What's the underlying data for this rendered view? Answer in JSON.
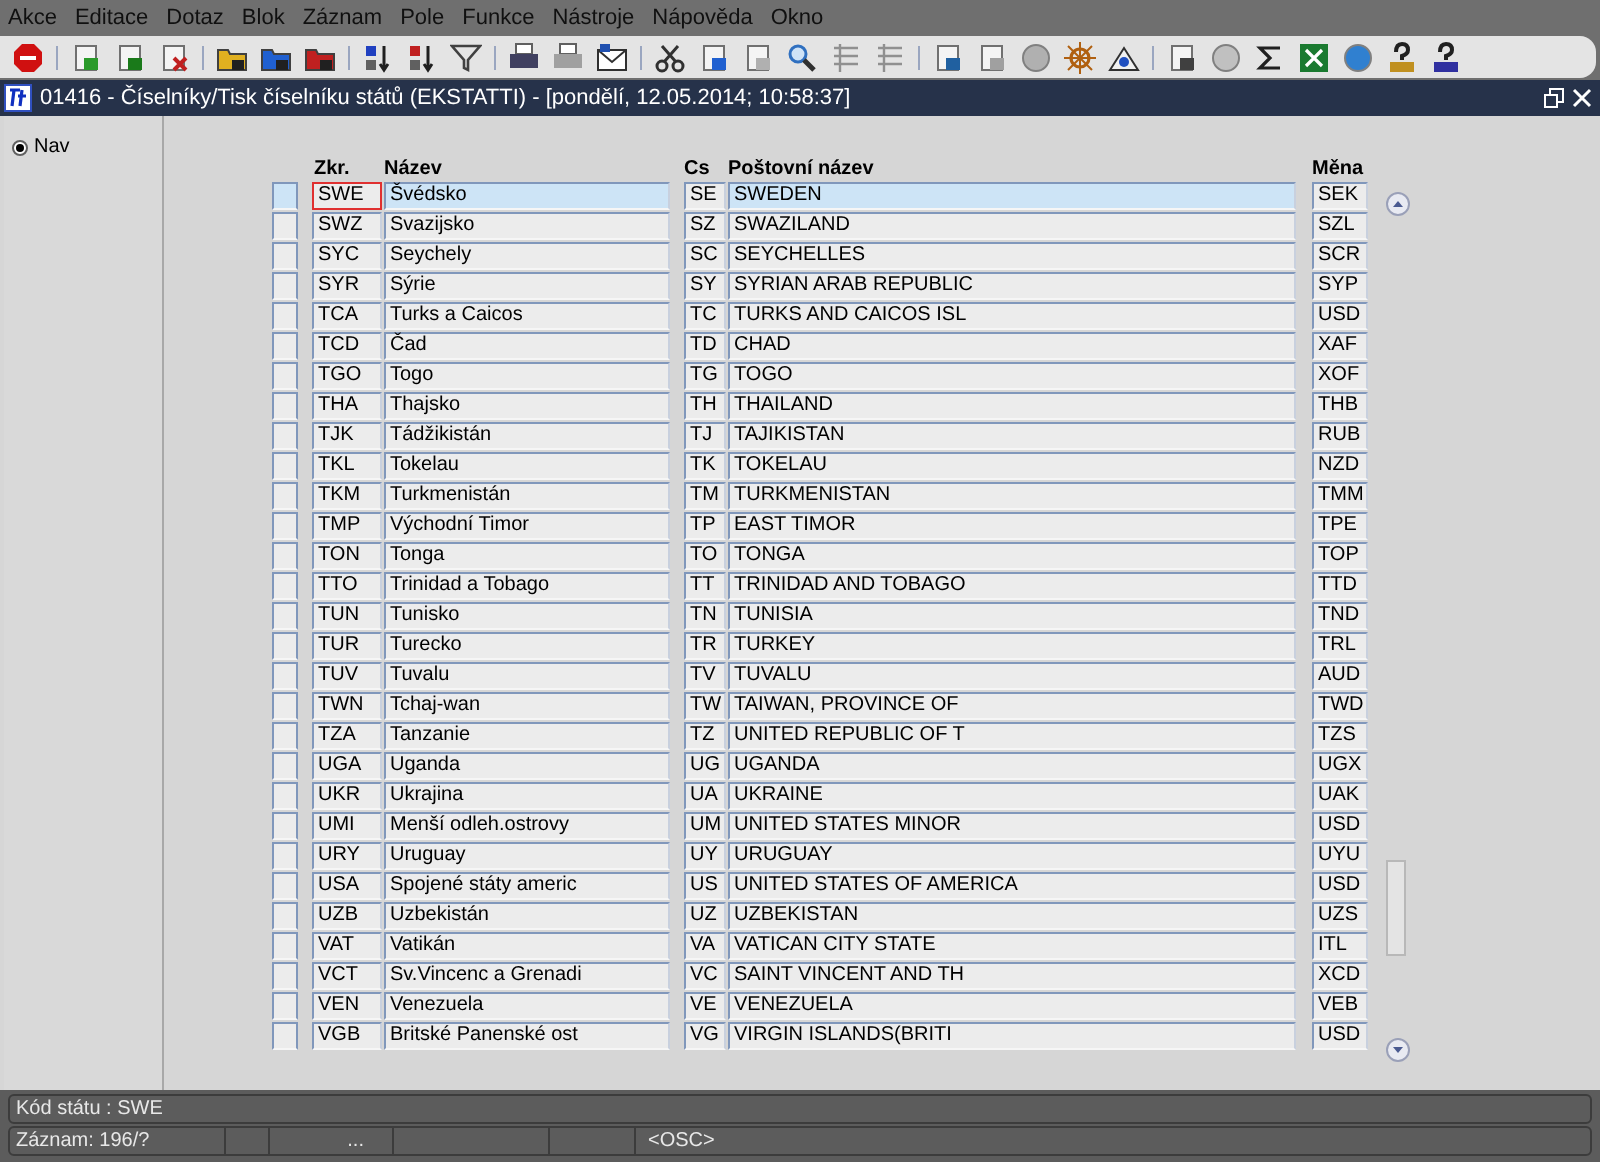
{
  "menu": [
    "Akce",
    "Editace",
    "Dotaz",
    "Blok",
    "Záznam",
    "Pole",
    "Funkce",
    "Nástroje",
    "Nápověda",
    "Okno"
  ],
  "window": {
    "title": "01416 - Číselníky/Tisk číselníku států (EKSTATTI) - [pondělí, 12.05.2014; 10:58:37]"
  },
  "nav": {
    "label": "Nav",
    "checked": true
  },
  "table": {
    "columns": {
      "zkr": "Zkr.",
      "nazev": "Název",
      "cs": "Cs",
      "postovni": "Poštovní název",
      "mena": "Měna"
    },
    "rows": [
      {
        "selected": true,
        "zkr": "SWE",
        "nazev": "Švédsko",
        "cs": "SE",
        "postovni": "SWEDEN",
        "mena": "SEK"
      },
      {
        "selected": false,
        "zkr": "SWZ",
        "nazev": "Svazijsko",
        "cs": "SZ",
        "postovni": "SWAZILAND",
        "mena": "SZL"
      },
      {
        "selected": false,
        "zkr": "SYC",
        "nazev": "Seychely",
        "cs": "SC",
        "postovni": "SEYCHELLES",
        "mena": "SCR"
      },
      {
        "selected": false,
        "zkr": "SYR",
        "nazev": "Sýrie",
        "cs": "SY",
        "postovni": "SYRIAN ARAB REPUBLIC",
        "mena": "SYP"
      },
      {
        "selected": false,
        "zkr": "TCA",
        "nazev": "Turks a Caicos",
        "cs": "TC",
        "postovni": "TURKS AND CAICOS ISL",
        "mena": "USD"
      },
      {
        "selected": false,
        "zkr": "TCD",
        "nazev": "Čad",
        "cs": "TD",
        "postovni": "CHAD",
        "mena": "XAF"
      },
      {
        "selected": false,
        "zkr": "TGO",
        "nazev": "Togo",
        "cs": "TG",
        "postovni": "TOGO",
        "mena": "XOF"
      },
      {
        "selected": false,
        "zkr": "THA",
        "nazev": "Thajsko",
        "cs": "TH",
        "postovni": "THAILAND",
        "mena": "THB"
      },
      {
        "selected": false,
        "zkr": "TJK",
        "nazev": "Tádžikistán",
        "cs": "TJ",
        "postovni": "TAJIKISTAN",
        "mena": "RUB"
      },
      {
        "selected": false,
        "zkr": "TKL",
        "nazev": "Tokelau",
        "cs": "TK",
        "postovni": "TOKELAU",
        "mena": "NZD"
      },
      {
        "selected": false,
        "zkr": "TKM",
        "nazev": "Turkmenistán",
        "cs": "TM",
        "postovni": "TURKMENISTAN",
        "mena": "TMM"
      },
      {
        "selected": false,
        "zkr": "TMP",
        "nazev": "Východní Timor",
        "cs": "TP",
        "postovni": "EAST TIMOR",
        "mena": "TPE"
      },
      {
        "selected": false,
        "zkr": "TON",
        "nazev": "Tonga",
        "cs": "TO",
        "postovni": "TONGA",
        "mena": "TOP"
      },
      {
        "selected": false,
        "zkr": "TTO",
        "nazev": "Trinidad a Tobago",
        "cs": "TT",
        "postovni": "TRINIDAD AND TOBAGO",
        "mena": "TTD"
      },
      {
        "selected": false,
        "zkr": "TUN",
        "nazev": "Tunisko",
        "cs": "TN",
        "postovni": "TUNISIA",
        "mena": "TND"
      },
      {
        "selected": false,
        "zkr": "TUR",
        "nazev": "Turecko",
        "cs": "TR",
        "postovni": "TURKEY",
        "mena": "TRL"
      },
      {
        "selected": false,
        "zkr": "TUV",
        "nazev": "Tuvalu",
        "cs": "TV",
        "postovni": "TUVALU",
        "mena": "AUD"
      },
      {
        "selected": false,
        "zkr": "TWN",
        "nazev": "Tchaj-wan",
        "cs": "TW",
        "postovni": "TAIWAN, PROVINCE OF",
        "mena": "TWD"
      },
      {
        "selected": false,
        "zkr": "TZA",
        "nazev": "Tanzanie",
        "cs": "TZ",
        "postovni": "UNITED REPUBLIC OF T",
        "mena": "TZS"
      },
      {
        "selected": false,
        "zkr": "UGA",
        "nazev": "Uganda",
        "cs": "UG",
        "postovni": "UGANDA",
        "mena": "UGX"
      },
      {
        "selected": false,
        "zkr": "UKR",
        "nazev": "Ukrajina",
        "cs": "UA",
        "postovni": "UKRAINE",
        "mena": "UAK"
      },
      {
        "selected": false,
        "zkr": "UMI",
        "nazev": "Menší odleh.ostrovy",
        "cs": "UM",
        "postovni": "UNITED STATES MINOR",
        "mena": "USD"
      },
      {
        "selected": false,
        "zkr": "URY",
        "nazev": "Uruguay",
        "cs": "UY",
        "postovni": "URUGUAY",
        "mena": "UYU"
      },
      {
        "selected": false,
        "zkr": "USA",
        "nazev": "Spojené státy americ",
        "cs": "US",
        "postovni": "UNITED STATES OF AMERICA",
        "mena": "USD"
      },
      {
        "selected": false,
        "zkr": "UZB",
        "nazev": "Uzbekistán",
        "cs": "UZ",
        "postovni": "UZBEKISTAN",
        "mena": "UZS"
      },
      {
        "selected": false,
        "zkr": "VAT",
        "nazev": "Vatikán",
        "cs": "VA",
        "postovni": "VATICAN CITY STATE",
        "mena": "ITL"
      },
      {
        "selected": false,
        "zkr": "VCT",
        "nazev": "Sv.Vincenc a Grenadi",
        "cs": "VC",
        "postovni": "SAINT VINCENT AND TH",
        "mena": "XCD"
      },
      {
        "selected": false,
        "zkr": "VEN",
        "nazev": "Venezuela",
        "cs": "VE",
        "postovni": "VENEZUELA",
        "mena": "VEB"
      },
      {
        "selected": false,
        "zkr": "VGB",
        "nazev": "Britské Panenské ost",
        "cs": "VG",
        "postovni": "VIRGIN ISLANDS(BRITI",
        "mena": "USD"
      }
    ]
  },
  "status_bar": {
    "field": "Kód státu : SWE",
    "record": "Záznam: 196/?",
    "ellipsis": "...",
    "mode": "<OSC>"
  }
}
